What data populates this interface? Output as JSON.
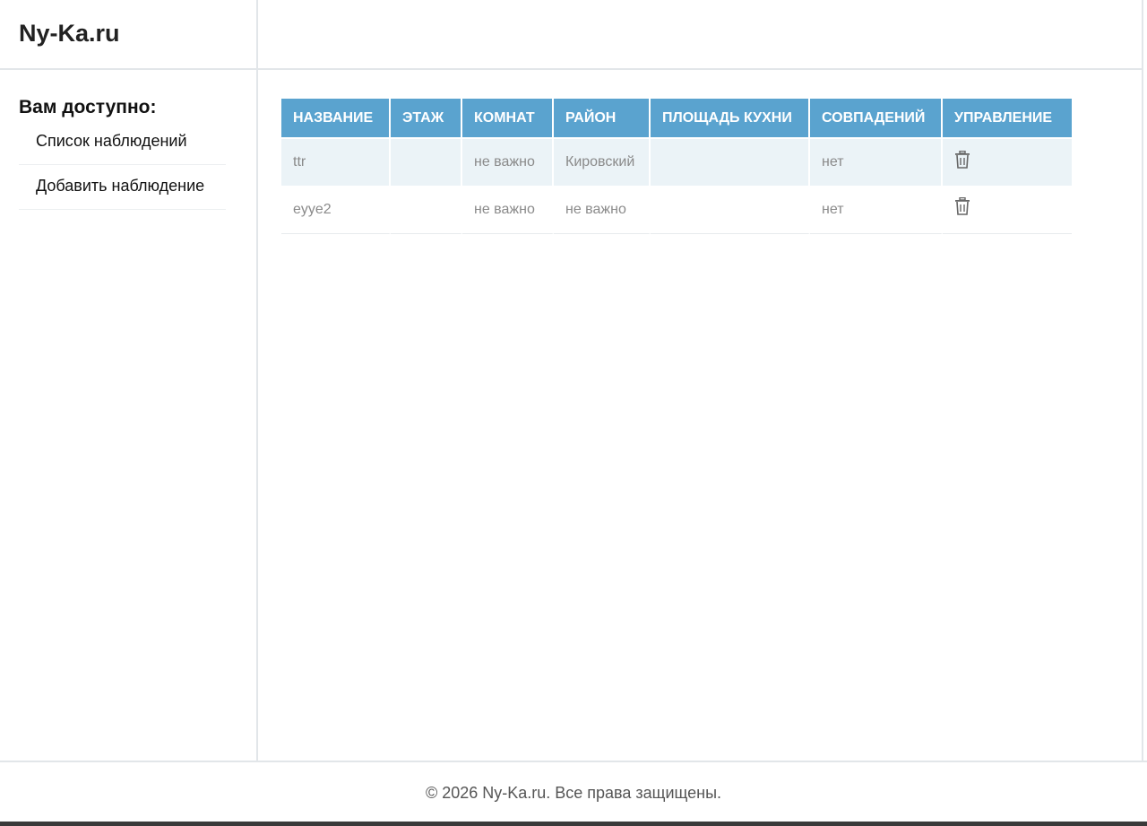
{
  "header": {
    "logo": "Ny-Ka.ru"
  },
  "sidebar": {
    "title": "Вам доступно:",
    "items": [
      {
        "label": "Список наблюдений"
      },
      {
        "label": "Добавить наблюдение"
      }
    ]
  },
  "table": {
    "columns": [
      "НАЗВАНИЕ",
      "ЭТАЖ",
      "КОМНАТ",
      "РАЙОН",
      "ПЛОЩАДЬ КУХНИ",
      "СОВПАДЕНИЙ",
      "УПРАВЛЕНИЕ"
    ],
    "rows": [
      {
        "name": "ttr",
        "floor": "",
        "rooms": "не важно",
        "district": "Кировский",
        "kitchen": "",
        "matches": "нет",
        "action_icon": "trash-icon"
      },
      {
        "name": "eyye2",
        "floor": "",
        "rooms": "не важно",
        "district": "не важно",
        "kitchen": "",
        "matches": "нет",
        "action_icon": "trash-icon"
      }
    ]
  },
  "footer": {
    "text": "© 2026 Ny-Ka.ru. Все права защищены."
  },
  "colors": {
    "table_header": "#5aa3cf",
    "row_stripe": "#ebf3f7"
  }
}
